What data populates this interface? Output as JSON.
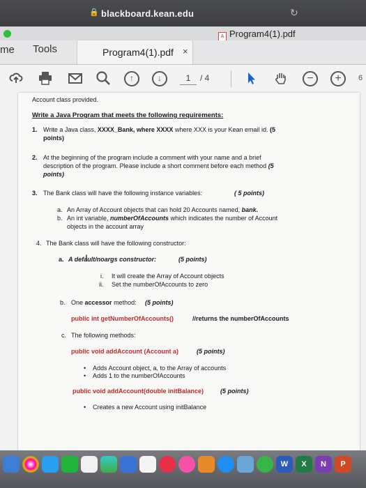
{
  "browser": {
    "url": "blackboard.kean.edu",
    "pdf_title": "Program4(1).pdf"
  },
  "tabs": {
    "home_label": "me",
    "tools_label": "Tools",
    "doc_label": "Program4(1).pdf",
    "close_label": "×"
  },
  "toolbar": {
    "page_current": "1",
    "page_total": "/ 4",
    "edge_label": "6"
  },
  "document": {
    "intro": "Account class provided.",
    "heading": "Write a Java Program that meets the following requirements:",
    "req1": {
      "num": "1.",
      "pre": "Write a Java class, ",
      "bold_class": "XXXX_Bank, where XXXX",
      "post": " where XXX is your Kean email id. ",
      "points": "(5",
      "points2": "points)"
    },
    "req2": {
      "num": "2.",
      "line1": "At the beginning of the program include a comment with your name and a brief",
      "line2_pre": "description of the program.  Please include a short comment before each method ",
      "line2_points": "(5",
      "line3": "points)"
    },
    "req3": {
      "num": "3.",
      "text": "The Bank class will have the following instance variables:",
      "points": "( 5 points)",
      "a_label": "a.",
      "a_pre": "An Array of Account objects that can hold 20 Accounts named, ",
      "a_bold": "bank.",
      "b_label": "b.",
      "b_pre": "An int variable, ",
      "b_bold": "numberOfAccounts",
      "b_post": " which indicates the number of Account",
      "b_line2": "objects in the account array"
    },
    "req4": {
      "num": "4.",
      "text": "The Bank class will have the following constructor:",
      "a_label": "a.",
      "a_text": "A default/noargs constructor:",
      "a_points": "(5 points)",
      "ai_label": "i.",
      "ai_text": "It will create the Array of Account objects",
      "aii_label": "ii.",
      "aii_text": "Set the numberOfAccounts to zero",
      "b_label": "b.",
      "b_pre": "One ",
      "b_bold": "accessor",
      "b_post": " method:",
      "b_points": "(5 points)",
      "b_code": "public int getNumberOfAccounts()",
      "b_comment": "//returns the numberOfAccounts",
      "c_label": "c.",
      "c_text": "The following methods:",
      "c_code1": "public void addAccount (Account a)",
      "c_points1": "(5 points)",
      "c_bullet1": "Adds Account object, a, to the Array of accounts",
      "c_bullet2": "Adds 1 to the numberOfAccounts",
      "c_code2": "public void addAccount(double initBalance)",
      "c_points2": "(5 points)",
      "c_bullet3": "Creates a new Account using initBalance"
    }
  },
  "dock": {
    "word_label": "W",
    "excel_label": "X",
    "onenote_label": "N",
    "ppt_label": "P"
  },
  "colors": {
    "code_red": "#c12a2a",
    "green_dot": "#2fbd3f"
  }
}
